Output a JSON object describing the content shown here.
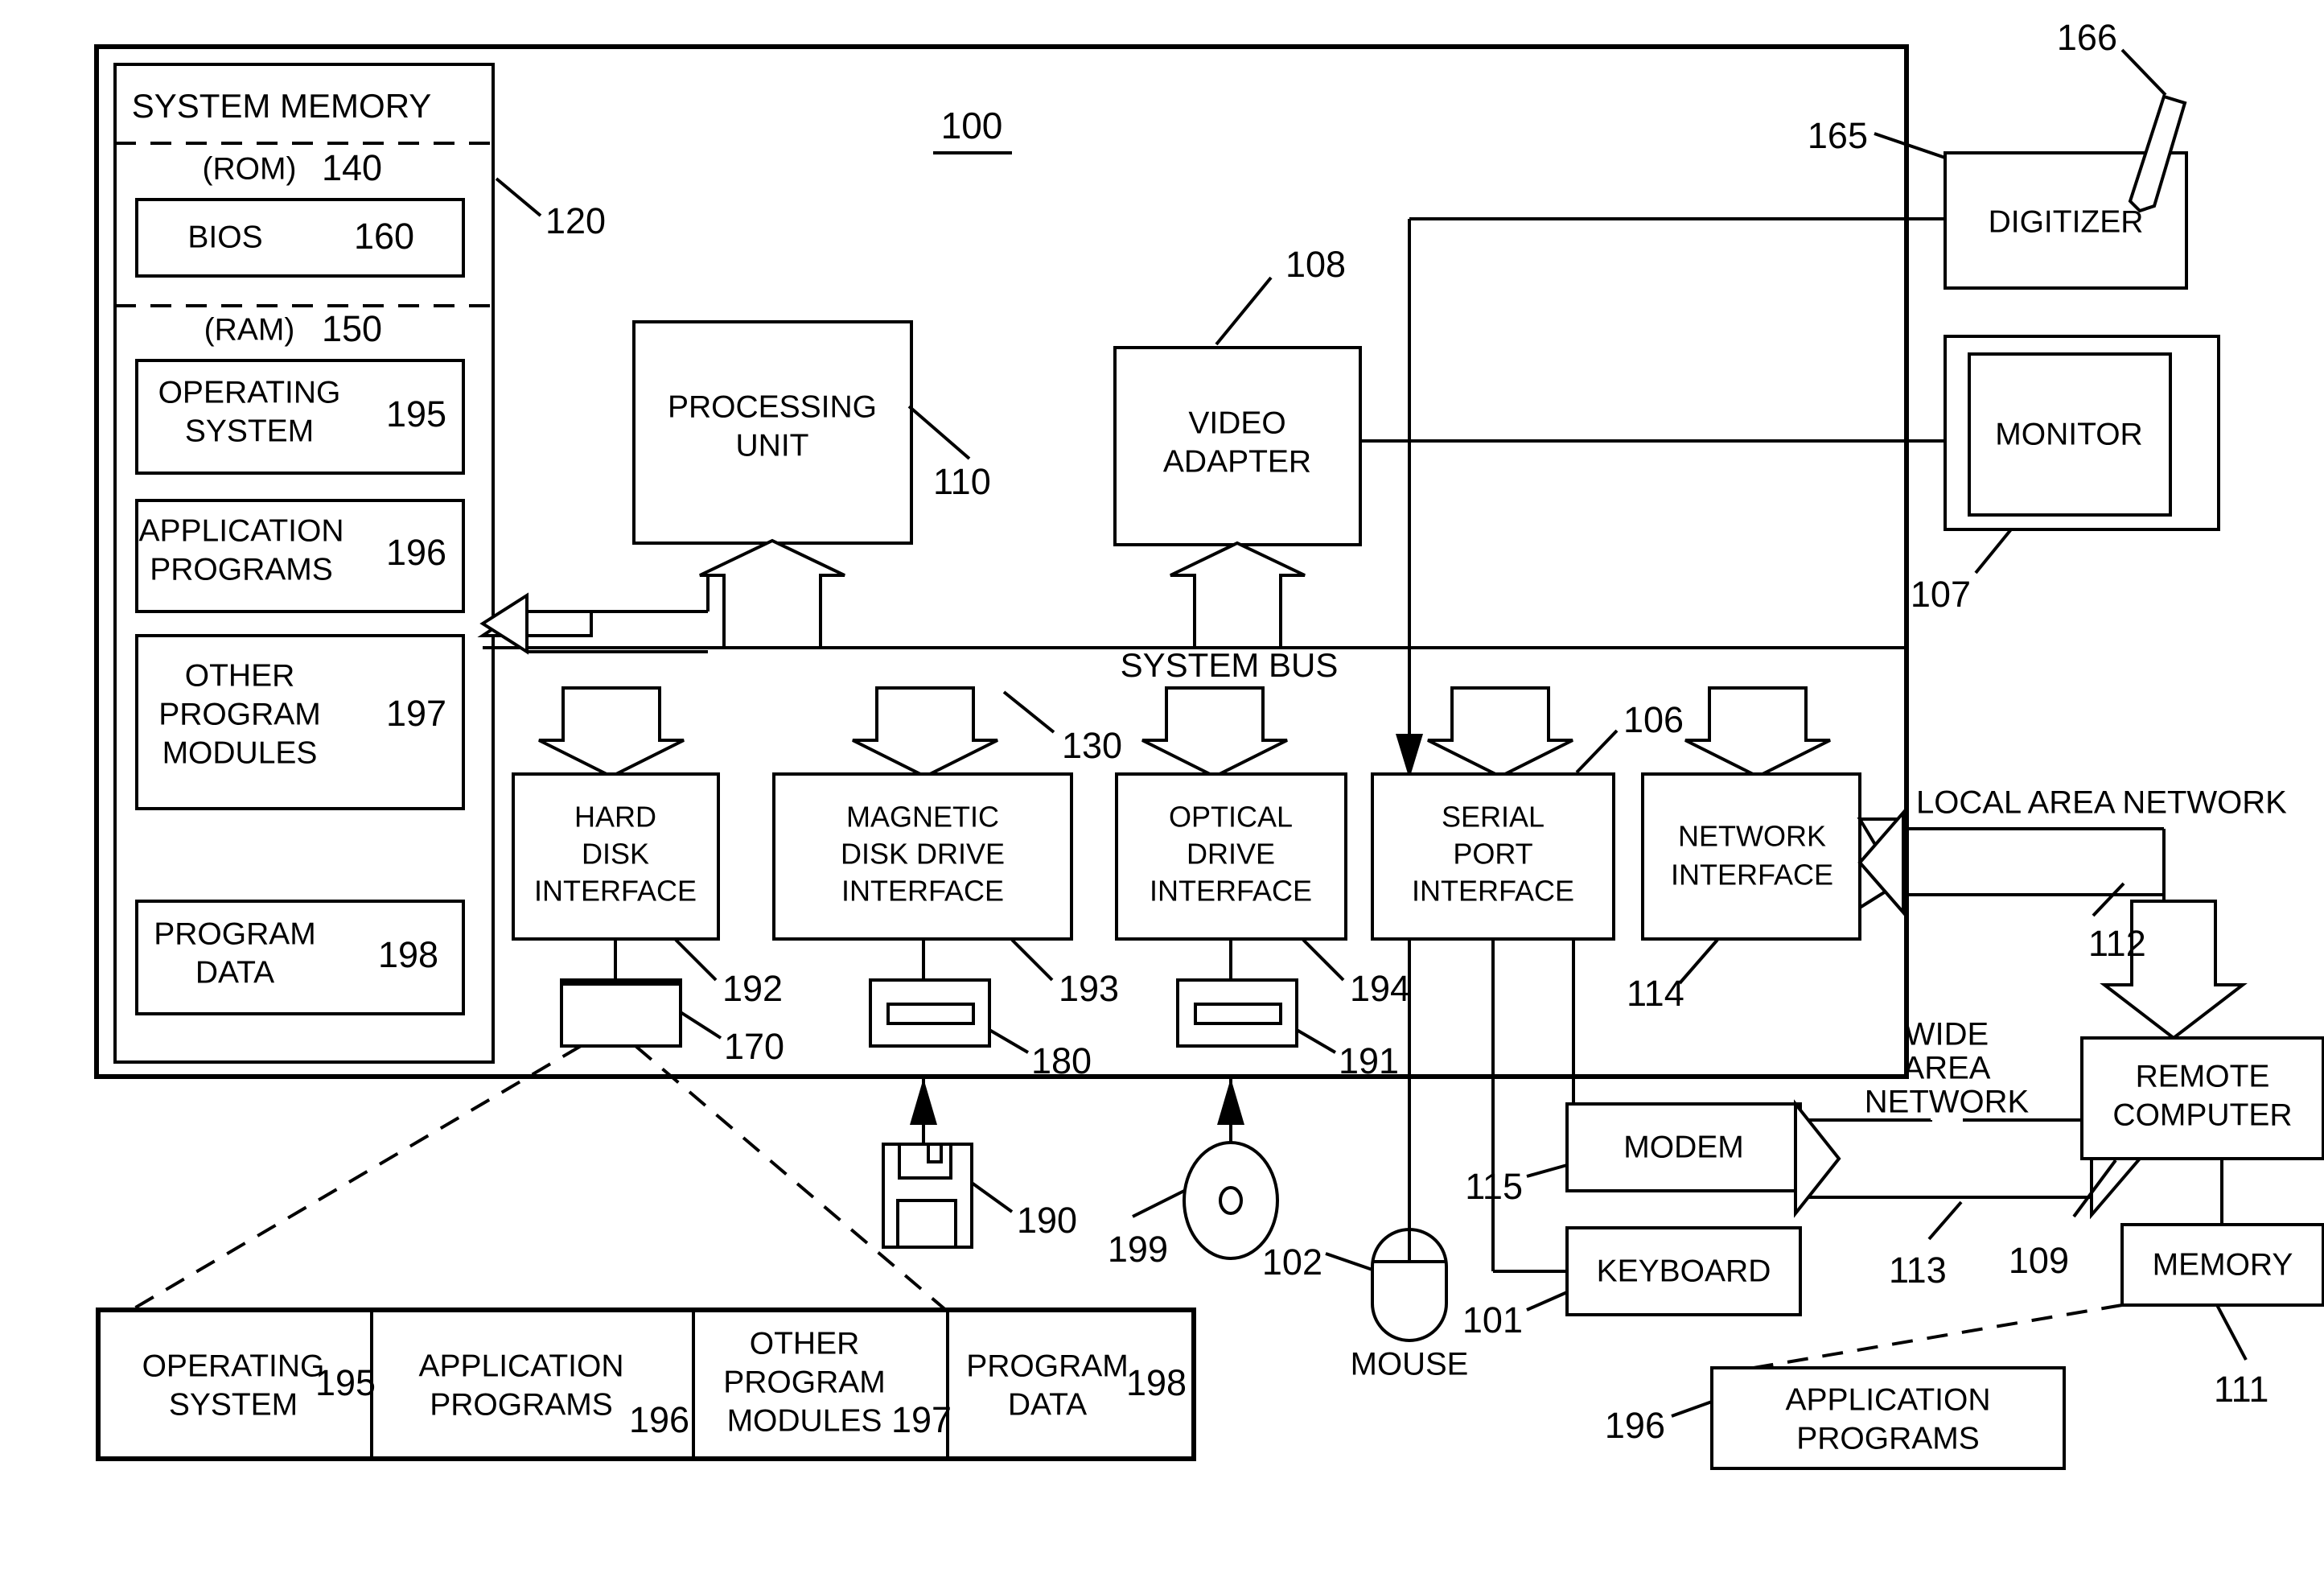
{
  "figure": {
    "number": "100"
  },
  "system_memory": {
    "title": "SYSTEM MEMORY",
    "ref": "120",
    "rom": {
      "label": "(ROM)",
      "ref": "140"
    },
    "bios": {
      "label": "BIOS",
      "ref": "160"
    },
    "ram": {
      "label": "(RAM)",
      "ref": "150"
    },
    "blocks": [
      {
        "label": "OPERATING\nSYSTEM",
        "line1": "OPERATING",
        "line2": "SYSTEM",
        "ref": "195"
      },
      {
        "label": "APPLICATION\nPROGRAMS",
        "line1": "APPLICATION",
        "line2": "PROGRAMS",
        "ref": "196"
      },
      {
        "label": "OTHER\nPROGRAM\nMODULES",
        "line1": "OTHER",
        "line2": "PROGRAM",
        "line3": "MODULES",
        "ref": "197"
      },
      {
        "label": "PROGRAM\nDATA",
        "line1": "PROGRAM",
        "line2": "DATA",
        "ref": "198"
      }
    ]
  },
  "core": {
    "processing_unit": {
      "line1": "PROCESSING",
      "line2": "UNIT",
      "ref": "110"
    },
    "video_adapter": {
      "line1": "VIDEO",
      "line2": "ADAPTER",
      "ref": "108"
    },
    "system_bus": {
      "label": "SYSTEM BUS",
      "ref": "130"
    }
  },
  "interfaces": [
    {
      "line1": "HARD",
      "line2": "DISK",
      "line3": "INTERFACE",
      "ref": "192"
    },
    {
      "line1": "MAGNETIC",
      "line2": "DISK DRIVE",
      "line3": "INTERFACE",
      "ref": "193"
    },
    {
      "line1": "OPTICAL",
      "line2": "DRIVE",
      "line3": "INTERFACE",
      "ref": "194"
    },
    {
      "line1": "SERIAL",
      "line2": "PORT",
      "line3": "INTERFACE",
      "ref": "106"
    },
    {
      "line1": "NETWORK",
      "line2": "INTERFACE",
      "line3": "",
      "ref": "114"
    }
  ],
  "drives": [
    {
      "name": "hard-disk-drive",
      "ref": "170"
    },
    {
      "name": "magnetic-disk-drive",
      "ref": "180"
    },
    {
      "name": "optical-drive",
      "ref": "191"
    }
  ],
  "media": {
    "floppy_disk": {
      "ref": "190"
    },
    "optical_disc": {
      "ref": "199"
    }
  },
  "peripherals": {
    "digitizer": {
      "label": "DIGITIZER",
      "ref": "165"
    },
    "stylus": {
      "ref": "166"
    },
    "monitor": {
      "label": "MONITOR",
      "ref": "107"
    },
    "mouse": {
      "label": "MOUSE",
      "ref": "102"
    },
    "keyboard": {
      "label": "KEYBOARD",
      "ref": "101"
    },
    "modem": {
      "label": "MODEM",
      "ref": "115"
    }
  },
  "networks": {
    "lan": {
      "label": "LOCAL AREA NETWORK",
      "ref": "112"
    },
    "wan": {
      "line1": "WIDE",
      "line2": "AREA",
      "line3": "NETWORK",
      "ref": "113"
    }
  },
  "remote": {
    "computer": {
      "line1": "REMOTE",
      "line2": "COMPUTER",
      "ref": "109"
    },
    "memory": {
      "label": "MEMORY",
      "ref": "111"
    },
    "application_programs": {
      "line1": "APPLICATION",
      "line2": "PROGRAMS",
      "ref": "196"
    }
  },
  "detail_strip": {
    "items": [
      {
        "line1": "OPERATING",
        "line2": "SYSTEM",
        "ref": "195"
      },
      {
        "line1": "APPLICATION",
        "line2": "PROGRAMS",
        "ref": "196"
      },
      {
        "line1": "OTHER",
        "line2": "PROGRAM",
        "line3": "MODULES",
        "ref": "197"
      },
      {
        "line1": "PROGRAM",
        "line2": "DATA",
        "ref": "198"
      }
    ]
  }
}
